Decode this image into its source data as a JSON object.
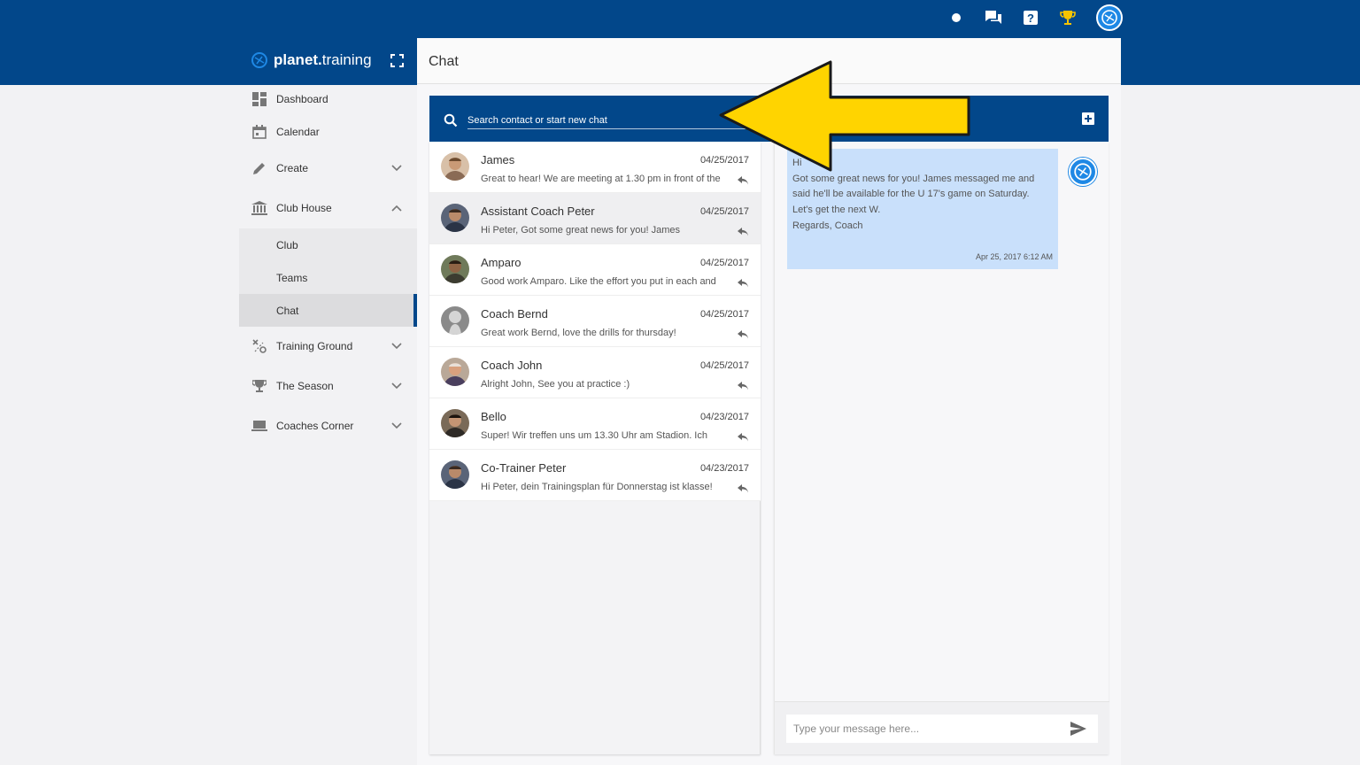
{
  "app": {
    "brand_bold": "planet.",
    "brand_light": "training"
  },
  "topbar": {
    "icons": [
      "status-dot-icon",
      "chat-icon",
      "help-icon",
      "trophy-icon",
      "profile-avatar-icon"
    ]
  },
  "sidebar": {
    "items": [
      {
        "label": "Dashboard",
        "icon": "dashboard-icon"
      },
      {
        "label": "Calendar",
        "icon": "calendar-icon"
      },
      {
        "label": "Create",
        "icon": "pencil-icon"
      },
      {
        "label": "Club House",
        "icon": "building-icon"
      },
      {
        "label": "Training Ground",
        "icon": "tactics-icon"
      },
      {
        "label": "The Season",
        "icon": "trophy-icon"
      },
      {
        "label": "Coaches Corner",
        "icon": "laptop-icon"
      }
    ],
    "subitems": [
      {
        "label": "Club"
      },
      {
        "label": "Teams"
      },
      {
        "label": "Chat",
        "active": true
      }
    ]
  },
  "page": {
    "title": "Chat"
  },
  "search": {
    "placeholder": "Search contact or start new chat"
  },
  "contacts": [
    {
      "name": "James",
      "date": "04/25/2017",
      "preview": "Great to hear! We are meeting at 1.30 pm in front of the"
    },
    {
      "name": "Assistant Coach Peter",
      "date": "04/25/2017",
      "preview": "Hi Peter, Got some great news for you! James"
    },
    {
      "name": "Amparo",
      "date": "04/25/2017",
      "preview": "Good work Amparo. Like the effort you put in each and"
    },
    {
      "name": "Coach Bernd",
      "date": "04/25/2017",
      "preview": "Great work Bernd, love the drills for thursday!"
    },
    {
      "name": "Coach John",
      "date": "04/25/2017",
      "preview": "Alright John, See you at practice :)"
    },
    {
      "name": "Bello",
      "date": "04/23/2017",
      "preview": "Super! Wir treffen uns um 13.30 Uhr am Stadion. Ich"
    },
    {
      "name": "Co-Trainer Peter",
      "date": "04/23/2017",
      "preview": "Hi Peter, dein Trainingsplan für Donnerstag ist klasse!"
    }
  ],
  "conversation": {
    "message": "Hi\nGot some great news for you! James messaged me and said he'll be available for the U 17's game on Saturday.\nLet's get the next W.\nRegards, Coach",
    "timestamp": "Apr 25, 2017 6:12 AM"
  },
  "compose": {
    "placeholder": "Type your message here..."
  },
  "colors": {
    "brand_blue": "#02478a",
    "accent_blue": "#1e88e5",
    "bubble": "#c9e0fb",
    "arrow_yellow": "#ffd400"
  }
}
